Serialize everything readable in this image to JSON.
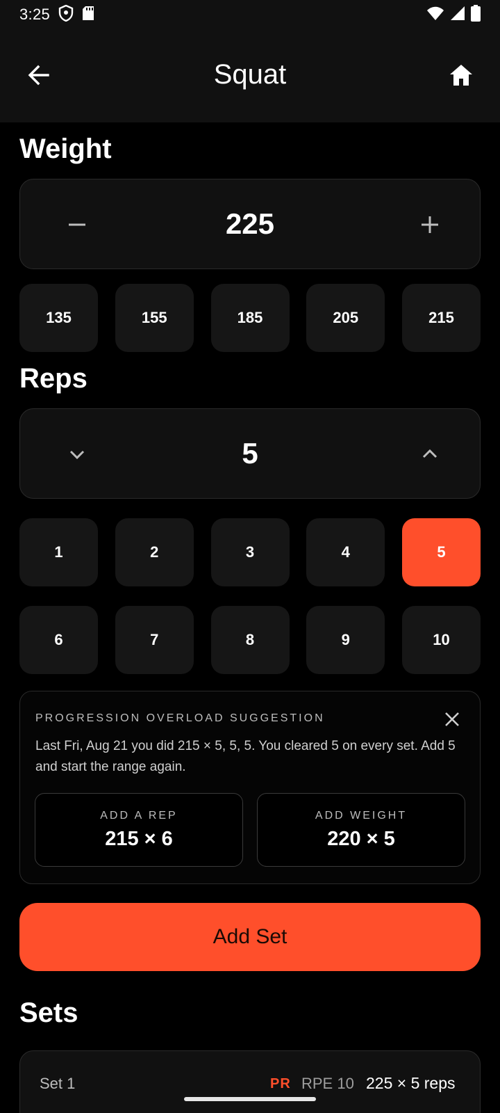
{
  "status_bar": {
    "time": "3:25",
    "icons": [
      "shield-icon",
      "sd-card-icon",
      "wifi-icon",
      "signal-icon",
      "battery-icon"
    ]
  },
  "app_bar": {
    "title": "Squat",
    "back_icon": "arrow-back-icon",
    "home_icon": "home-icon"
  },
  "weight": {
    "section_title": "Weight",
    "value": "225",
    "decrement_icon": "minus-icon",
    "increment_icon": "plus-icon",
    "quick_values": [
      "135",
      "155",
      "185",
      "205",
      "215"
    ]
  },
  "reps": {
    "section_title": "Reps",
    "value": "5",
    "decrement_icon": "chevron-down-icon",
    "increment_icon": "chevron-up-icon",
    "quick_values_row1": [
      "1",
      "2",
      "3",
      "4",
      "5"
    ],
    "quick_values_row2": [
      "6",
      "7",
      "8",
      "9",
      "10"
    ],
    "selected": "5"
  },
  "suggestion": {
    "heading": "PROGRESSION OVERLOAD SUGGESTION",
    "message": "Last Fri, Aug 21 you did 215 × 5, 5, 5. You cleared 5 on every set. Add 5 and start the range again.",
    "options": [
      {
        "label": "ADD A REP",
        "value": "215 × 6"
      },
      {
        "label": "ADD WEIGHT",
        "value": "220 × 5"
      }
    ]
  },
  "add_set_label": "Add Set",
  "sets": {
    "section_title": "Sets",
    "items": [
      {
        "label": "Set 1",
        "badge": "PR",
        "rpe": "RPE 10",
        "result": "225 × 5 reps"
      }
    ]
  },
  "colors": {
    "accent": "#ff4f2b",
    "background": "#000000",
    "surface": "#111111",
    "chip": "#161616"
  }
}
